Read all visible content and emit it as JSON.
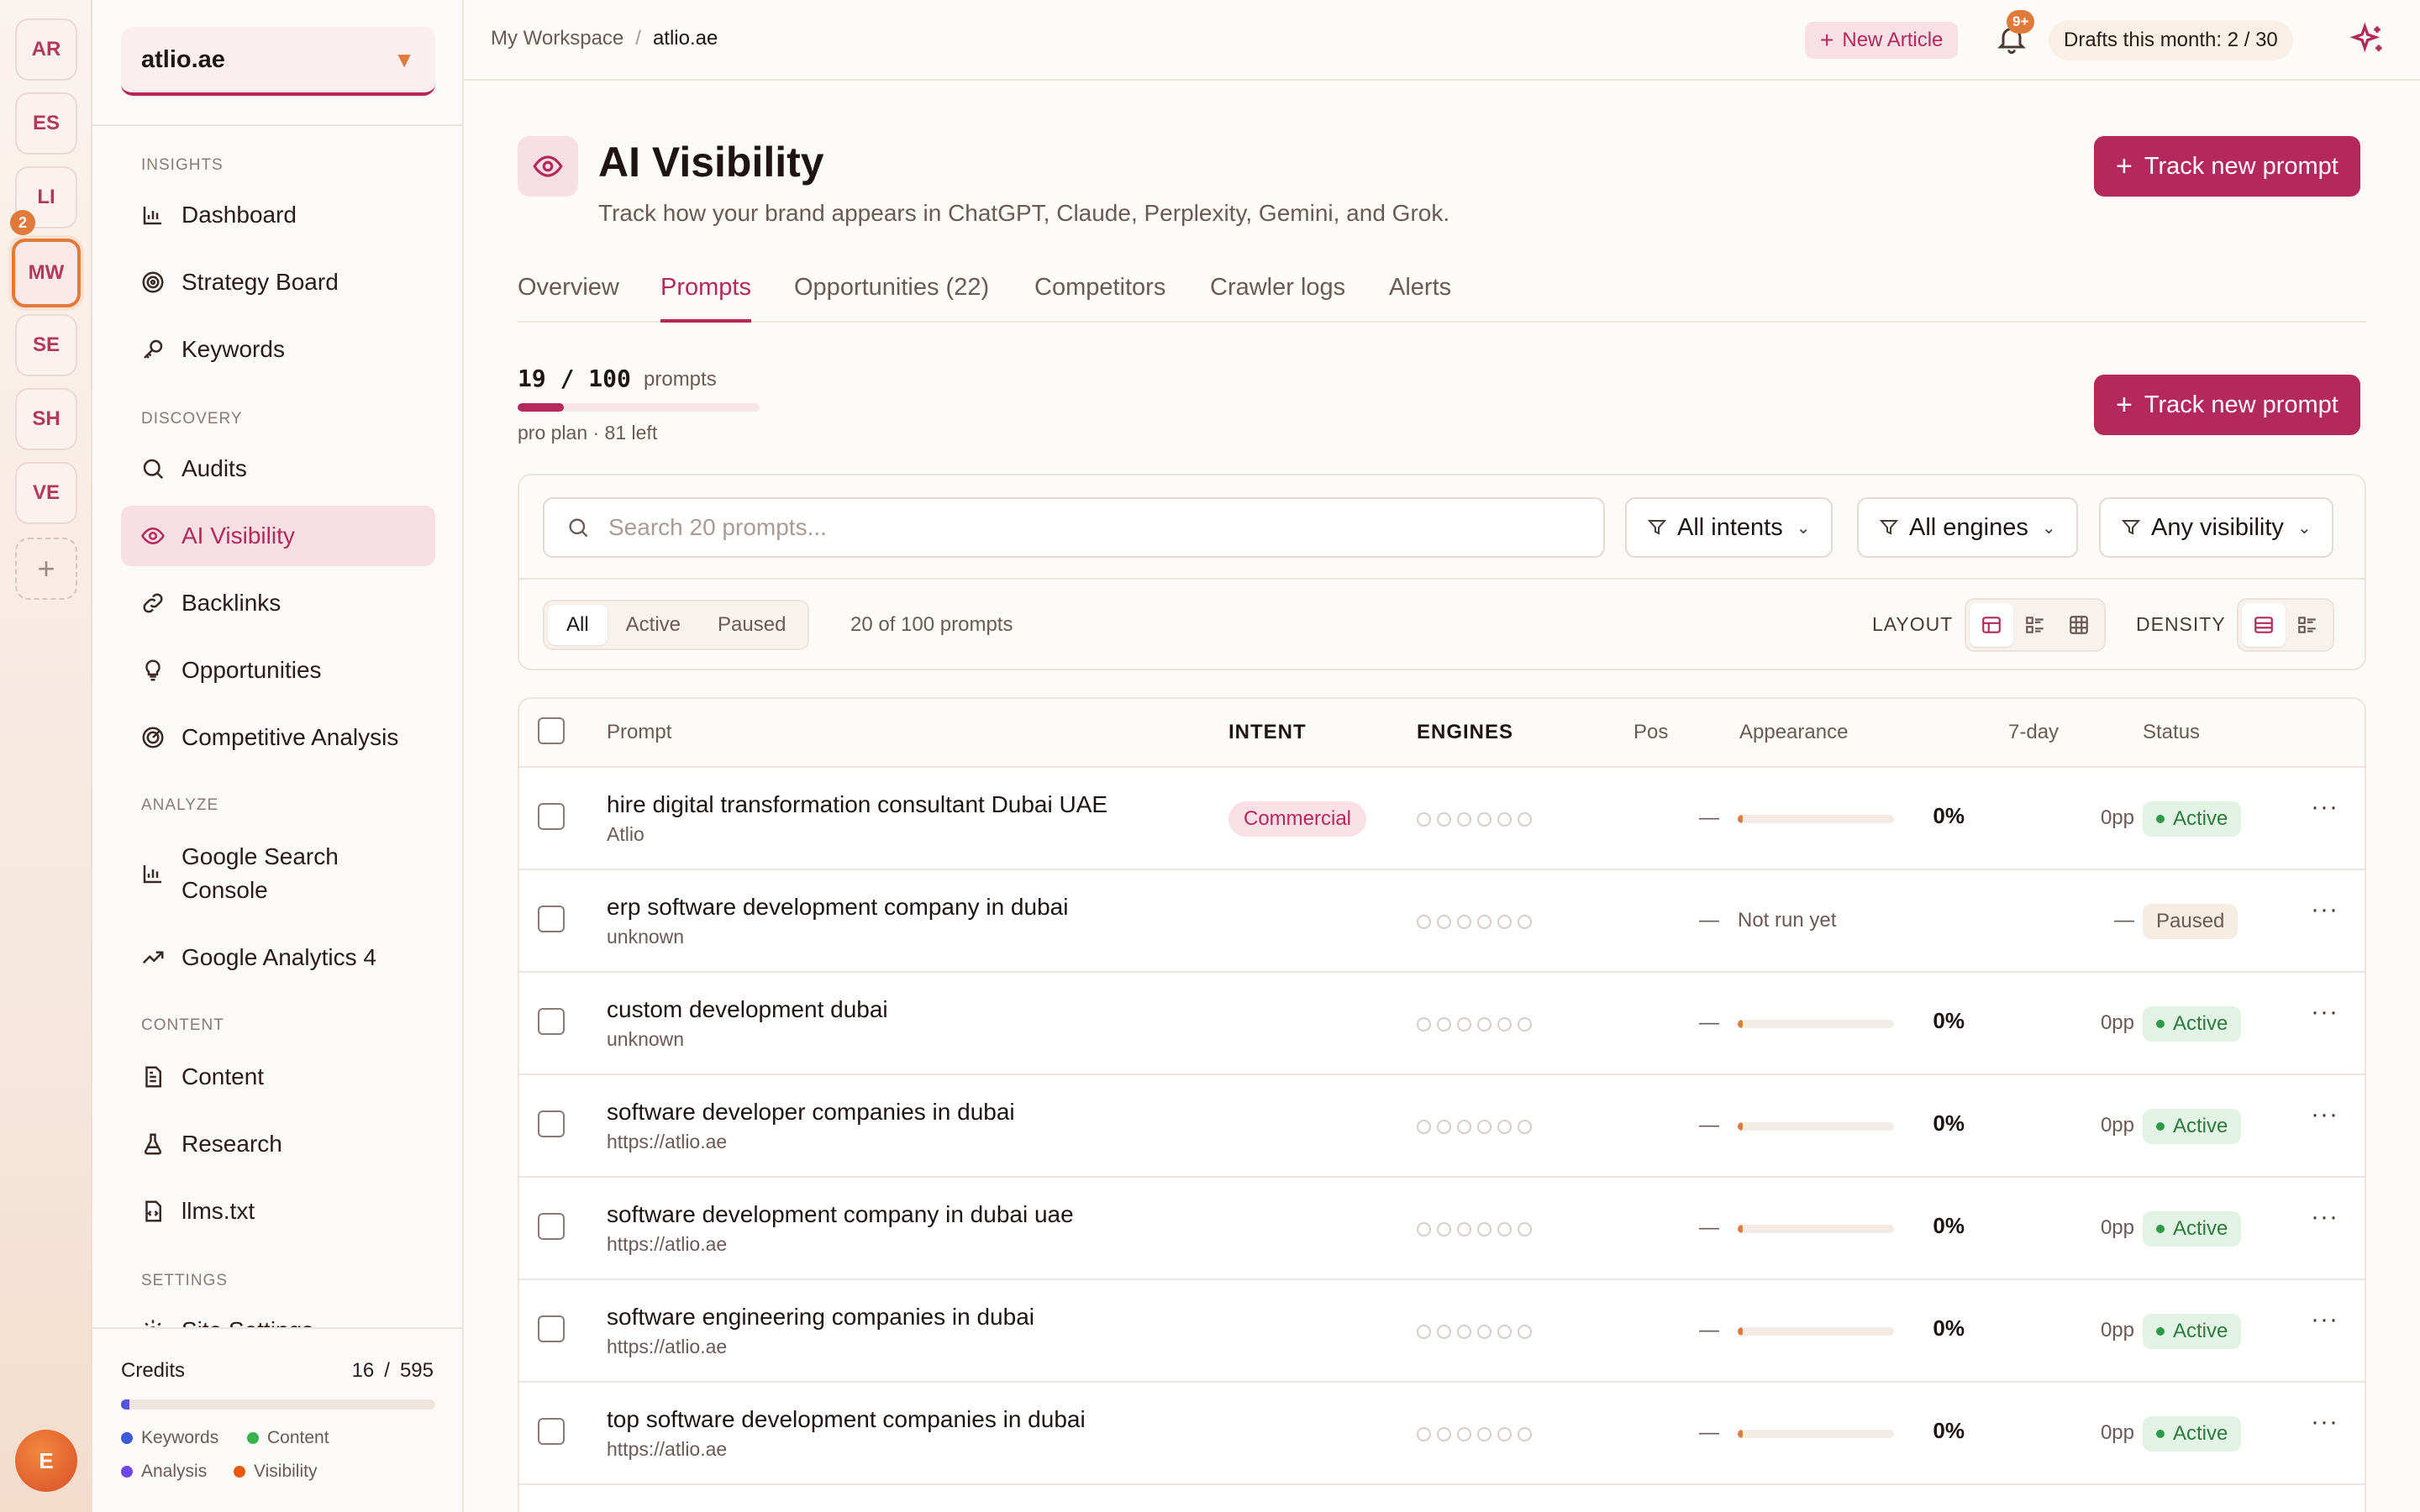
{
  "workspaces": [
    {
      "initials": "AR",
      "badge": null
    },
    {
      "initials": "ES",
      "badge": null
    },
    {
      "initials": "LI",
      "badge": null
    },
    {
      "initials": "MW",
      "badge": "2"
    },
    {
      "initials": "SE",
      "badge": null
    },
    {
      "initials": "SH",
      "badge": null
    },
    {
      "initials": "VE",
      "badge": null
    }
  ],
  "workspace_add": "+",
  "user_initial": "E",
  "sidebar": {
    "site": "atlio.ae",
    "sections": {
      "insights": "INSIGHTS",
      "discovery": "DISCOVERY",
      "analyze": "ANALYZE",
      "content": "CONTENT",
      "settings": "SETTINGS"
    },
    "items": {
      "dashboard": "Dashboard",
      "strategy": "Strategy Board",
      "keywords": "Keywords",
      "audits": "Audits",
      "ai_visibility": "AI Visibility",
      "backlinks": "Backlinks",
      "opportunities": "Opportunities",
      "competitive": "Competitive Analysis",
      "gsc_line1": "Google Search",
      "gsc_line2": "Console",
      "ga4": "Google Analytics 4",
      "content": "Content",
      "research": "Research",
      "llms": "llms.txt",
      "site_settings": "Site Settings"
    },
    "credits": {
      "title": "Credits",
      "used": "16",
      "total": "595",
      "fraction": 0.027,
      "legend": {
        "keywords": "Keywords",
        "content": "Content",
        "analysis": "Analysis",
        "visibility": "Visibility"
      },
      "colors": {
        "keywords": "#3b5bdb",
        "content": "#37b24d",
        "analysis": "#7048e8",
        "visibility": "#e8590c"
      }
    }
  },
  "header": {
    "breadcrumb_root": "My Workspace",
    "breadcrumb_sep": "/",
    "breadcrumb_current": "atlio.ae",
    "new_article": "New Article",
    "notifications_badge": "9+",
    "drafts": "Drafts this month: 2 / 30"
  },
  "page": {
    "title": "AI Visibility",
    "subtitle": "Track how your brand appears in ChatGPT, Claude, Perplexity, Gemini, and Grok.",
    "track_button": "Track new prompt",
    "tabs": [
      "Overview",
      "Prompts",
      "Opportunities (22)",
      "Competitors",
      "Crawler logs",
      "Alerts"
    ],
    "active_tab": "Prompts"
  },
  "quota": {
    "text": "19 / 100",
    "unit": "prompts",
    "fraction": 0.19,
    "plan": "pro plan · 81 left"
  },
  "filters": {
    "search_placeholder": "Search 20 prompts...",
    "intents": "All intents",
    "engines": "All engines",
    "visibility": "Any visibility",
    "segments": [
      "All",
      "Active",
      "Paused"
    ],
    "count": "20 of 100 prompts",
    "layout_label": "LAYOUT",
    "density_label": "DENSITY"
  },
  "table": {
    "headers": {
      "prompt": "Prompt",
      "intent": "INTENT",
      "engines": "ENGINES",
      "pos": "Pos",
      "appearance": "Appearance",
      "sevenday": "7-day",
      "status": "Status"
    },
    "rows": [
      {
        "prompt": "hire digital transformation consultant Dubai UAE",
        "source": "Atlio",
        "intent": "Commercial",
        "pos": "—",
        "appearance": "0%",
        "appearance_fraction": 0.03,
        "not_run": null,
        "sevenday": "0pp",
        "status": "Active"
      },
      {
        "prompt": "erp software development company in dubai",
        "source": "unknown",
        "intent": null,
        "pos": "—",
        "appearance": null,
        "appearance_fraction": null,
        "not_run": "Not run yet",
        "sevenday": "—",
        "status": "Paused"
      },
      {
        "prompt": "custom development dubai",
        "source": "unknown",
        "intent": null,
        "pos": "—",
        "appearance": "0%",
        "appearance_fraction": 0.03,
        "not_run": null,
        "sevenday": "0pp",
        "status": "Active"
      },
      {
        "prompt": "software developer companies in dubai",
        "source": "https://atlio.ae",
        "intent": null,
        "pos": "—",
        "appearance": "0%",
        "appearance_fraction": 0.03,
        "not_run": null,
        "sevenday": "0pp",
        "status": "Active"
      },
      {
        "prompt": "software development company in dubai uae",
        "source": "https://atlio.ae",
        "intent": null,
        "pos": "—",
        "appearance": "0%",
        "appearance_fraction": 0.03,
        "not_run": null,
        "sevenday": "0pp",
        "status": "Active"
      },
      {
        "prompt": "software engineering companies in dubai",
        "source": "https://atlio.ae",
        "intent": null,
        "pos": "—",
        "appearance": "0%",
        "appearance_fraction": 0.03,
        "not_run": null,
        "sevenday": "0pp",
        "status": "Active"
      },
      {
        "prompt": "top software development companies in dubai",
        "source": "https://atlio.ae",
        "intent": null,
        "pos": "—",
        "appearance": "0%",
        "appearance_fraction": 0.03,
        "not_run": null,
        "sevenday": "0pp",
        "status": "Active"
      }
    ],
    "more_label": "···"
  },
  "colors": {
    "accent": "#b3295a",
    "orange": "#e07a3a",
    "active_green": "#2d7a3e"
  }
}
